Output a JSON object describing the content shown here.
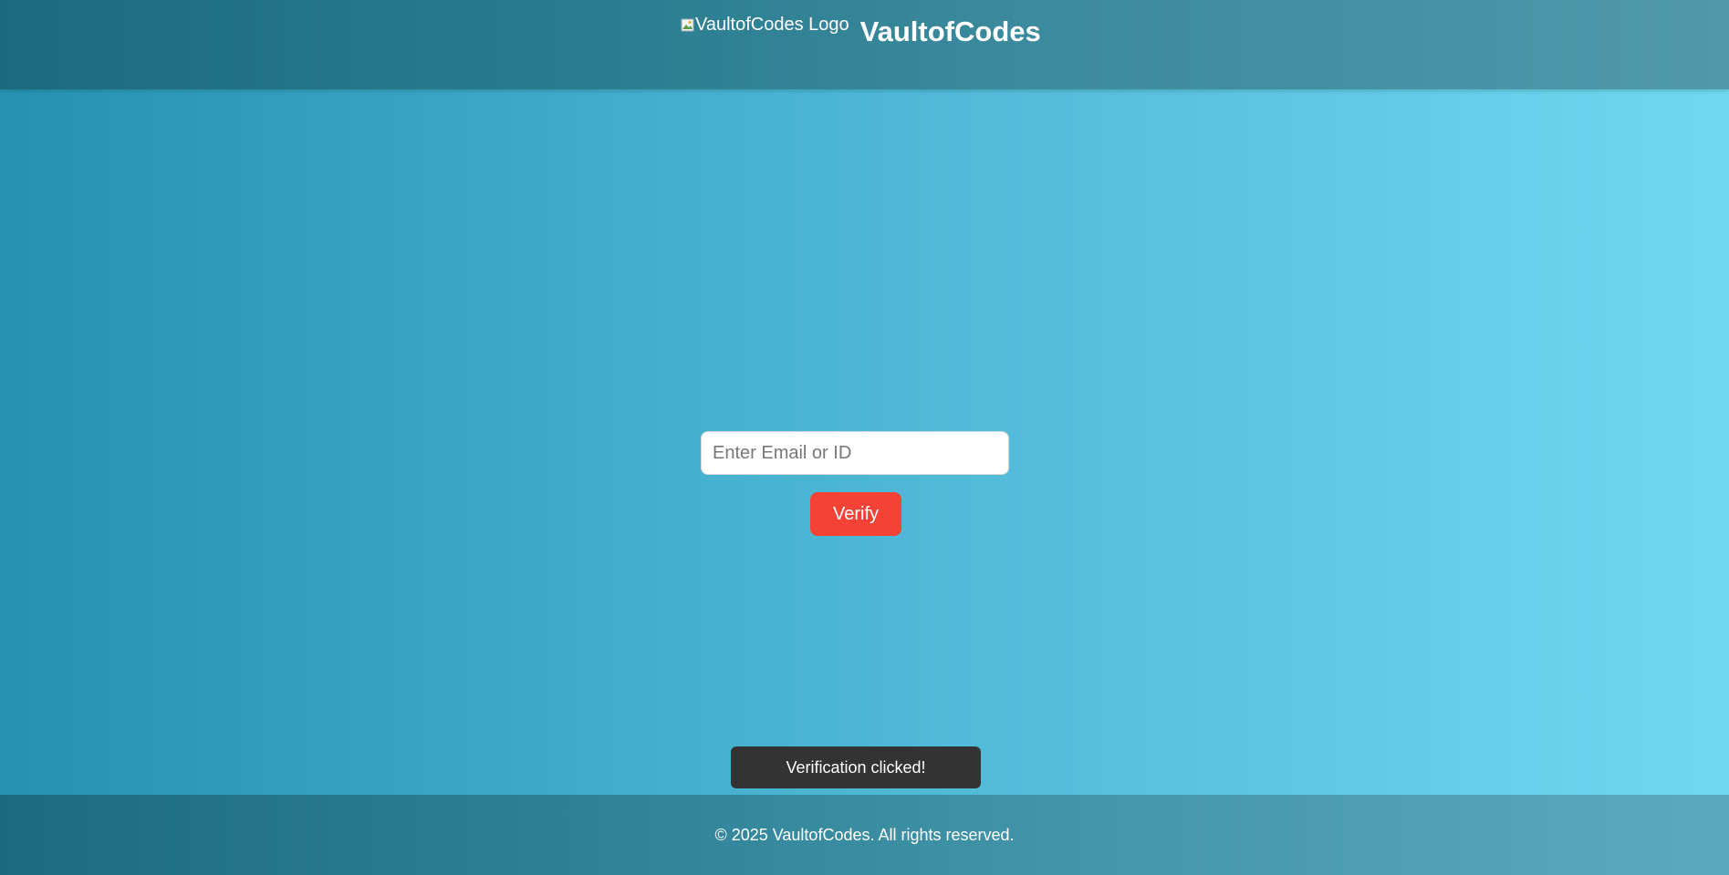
{
  "header": {
    "logo_alt": "VaultofCodes Logo",
    "title": "VaultofCodes"
  },
  "form": {
    "input_placeholder": "Enter Email or ID",
    "input_value": "",
    "verify_label": "Verify"
  },
  "toast": {
    "message": "Verification clicked!"
  },
  "footer": {
    "copyright": "© 2025 VaultofCodes. All rights reserved."
  },
  "colors": {
    "verify_button": "#f44336",
    "toast_background": "#333333",
    "header_start": "#1b6b80",
    "background_start": "#2592b0",
    "background_end": "#70d8f0"
  },
  "icons": {
    "logo": "broken-image-icon"
  }
}
